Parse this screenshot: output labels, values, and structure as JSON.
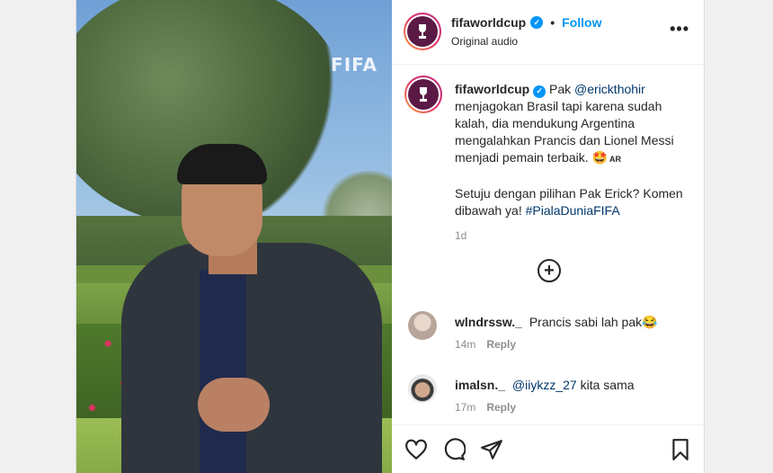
{
  "post": {
    "account": "fifaworldcup",
    "follow_label": "Follow",
    "separator": "•",
    "audio": "Original audio",
    "more_label": "•••"
  },
  "caption": {
    "username": "fifaworldcup",
    "text_before_mention": "Pak ",
    "mention": "@erickthohir",
    "text_after_mention": " menjagokan Brasil tapi karena sudah kalah, dia mendukung Argentina mengalahkan Prancis dan Lionel Messi menjadi pemain terbaik. ",
    "emoji": "🤩",
    "flag_label": "AR",
    "question": "Setuju dengan pilihan Pak Erick? Komen dibawah ya! ",
    "hashtag": "#PialaDuniaFIFA",
    "time": "1d"
  },
  "media": {
    "watermark": "FIFA"
  },
  "comments": [
    {
      "username": "wlndrssw._",
      "text": "Prancis sabi lah pak😂",
      "time": "14m",
      "reply_label": "Reply"
    },
    {
      "username": "imalsn._",
      "mention": "@iiykzz_27",
      "text": " kita sama",
      "time": "17m",
      "reply_label": "Reply"
    }
  ],
  "icons": [
    "heart-icon",
    "comment-icon",
    "share-icon",
    "bookmark-icon",
    "add-circle-icon",
    "more-icon",
    "verified-icon"
  ],
  "colors": {
    "link": "#00376b",
    "follow": "#0095f6",
    "muted": "#8e8e8e"
  }
}
